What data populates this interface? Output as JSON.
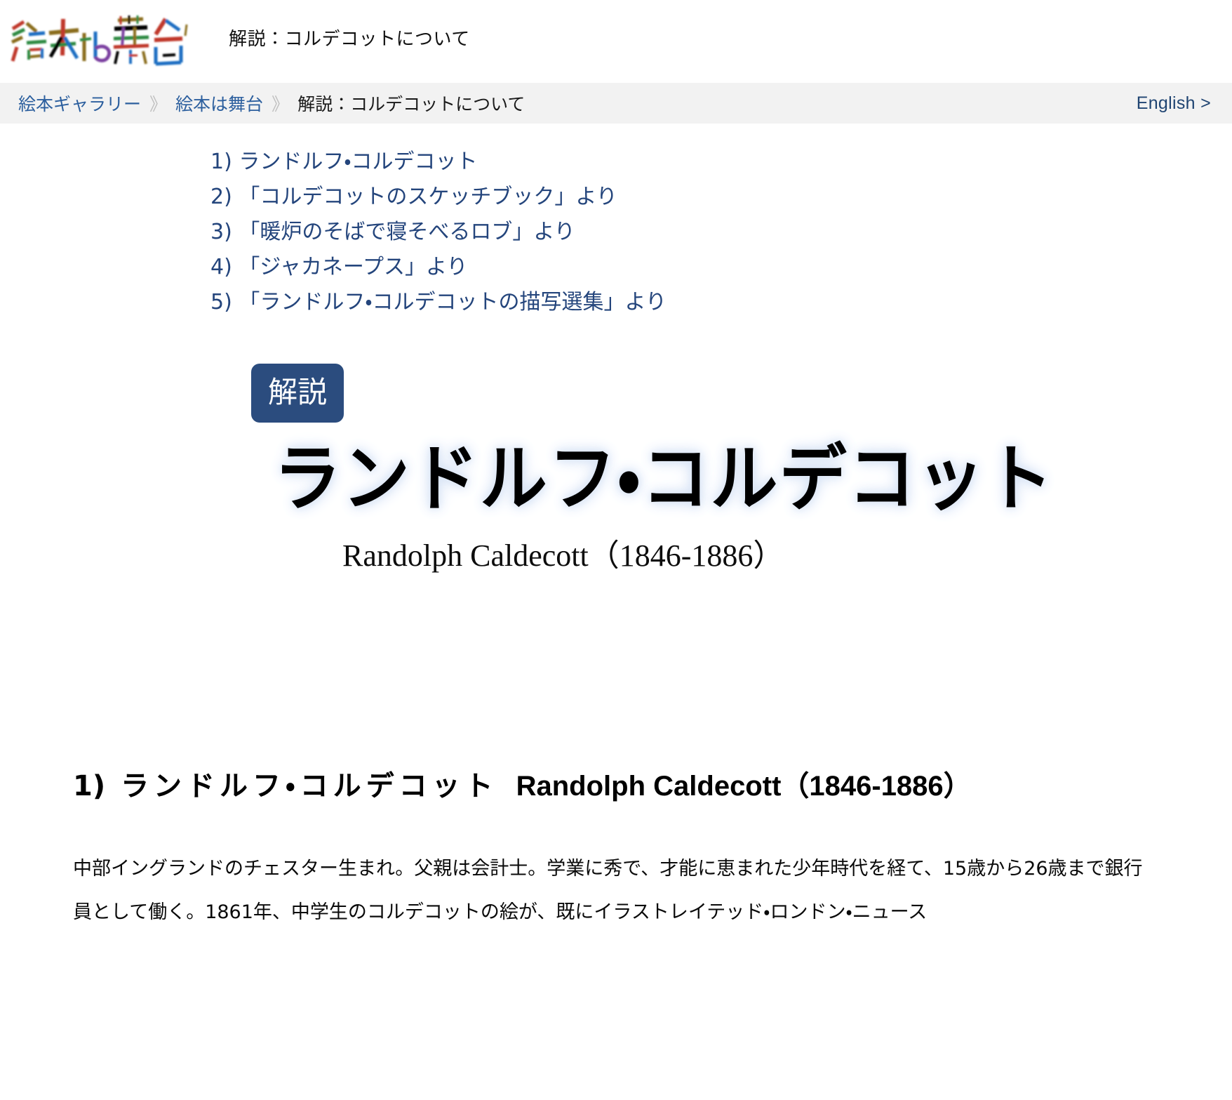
{
  "header": {
    "logo_alt": "絵本は舞台",
    "logo_chars": [
      {
        "ch": "絵",
        "color": "#c0392b"
      },
      {
        "ch": "本",
        "color": "#8a6d1f"
      },
      {
        "ch": "は",
        "color": "#1b6ec2"
      },
      {
        "ch": "舞",
        "color": "#2d8a42"
      },
      {
        "ch": "台",
        "color": "#7b3fa0"
      }
    ],
    "title": "解説：コルデコットについて"
  },
  "breadcrumb": {
    "items": [
      {
        "label": "絵本ギャラリー",
        "current": false
      },
      {
        "label": "絵本は舞台",
        "current": false
      },
      {
        "label": "解説：コルデコットについて",
        "current": true
      }
    ],
    "separator": "》",
    "lang_link": "English >"
  },
  "toc": {
    "items": [
      {
        "num": "1)",
        "label": "ランドルフ・コルデコット"
      },
      {
        "num": "2)",
        "label": "「コルデコットのスケッチブック」より"
      },
      {
        "num": "3)",
        "label": "「暖炉のそばで寝そべるロブ」より"
      },
      {
        "num": "4)",
        "label": "「ジャカネープス」より"
      },
      {
        "num": "5)",
        "label": "「ランドルフ・コルデコットの描写選集」より"
      }
    ]
  },
  "feature": {
    "badge": "解説",
    "title_jp": "ランドルフ・コルデコット",
    "title_en": "Randolph Caldecott（1846-1886）"
  },
  "section": {
    "heading_num": "1)",
    "heading_jp": "ランドルフ・コルデコット",
    "heading_en": "Randolph Caldecott（1846-1886）",
    "body": "中部イングランドのチェスター生まれ。父親は会計士。学業に秀で、才能に恵まれた少年時代を経て、15歳から26歳まで銀行員として働く。1861年、中学生のコルデコットの絵が、既にイラストレイテッド・ロンドン・ニュース"
  },
  "colors": {
    "accent_navy": "#2b4c7e",
    "link_blue": "#2c5f9e",
    "toc_blue": "#24457c",
    "bar_bg": "#f2f2f2"
  }
}
